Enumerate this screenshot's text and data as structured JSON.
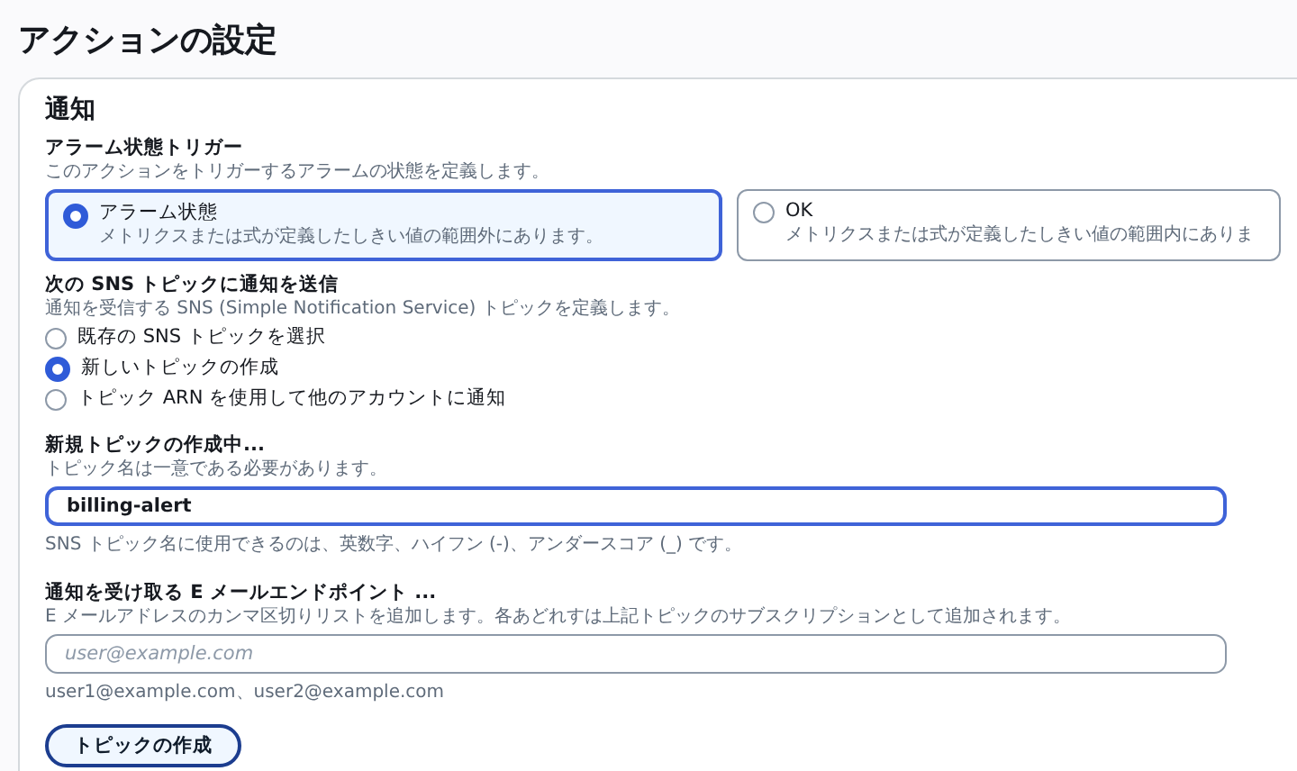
{
  "page_title": "アクションの設定",
  "card": {
    "title": "通知",
    "trigger": {
      "label": "アラーム状態トリガー",
      "description": "このアクションをトリガーするアラームの状態を定義します。",
      "options": [
        {
          "label": "アラーム状態",
          "description": "メトリクスまたは式が定義したしきい値の範囲外にあります。",
          "selected": true
        },
        {
          "label": "OK",
          "description": "メトリクスまたは式が定義したしきい値の範囲内にありま",
          "selected": false
        }
      ]
    },
    "sns": {
      "label": "次の SNS トピックに通知を送信",
      "description": "通知を受信する SNS (Simple Notification Service) トピックを定義します。",
      "options": [
        {
          "label": "既存の SNS トピックを選択",
          "selected": false
        },
        {
          "label": "新しいトピックの作成",
          "selected": true
        },
        {
          "label": "トピック ARN を使用して他のアカウントに通知",
          "selected": false
        }
      ]
    },
    "topic_name": {
      "label": "新規トピックの作成中...",
      "description": "トピック名は一意である必要があります。",
      "value": "billing-alert",
      "hint": "SNS トピック名に使用できるのは、英数字、ハイフン (-)、アンダースコア (_) です。",
      "focused": true
    },
    "email": {
      "label": "通知を受け取る E メールエンドポイント ...",
      "description": "E メールアドレスのカンマ区切りリストを追加します。各あどれすは上記トピックのサブスクリプションとして追加されます。",
      "placeholder": "user@example.com",
      "hint": "user1@example.com、user2@example.com",
      "focused": false
    },
    "button": "トピックの作成"
  }
}
